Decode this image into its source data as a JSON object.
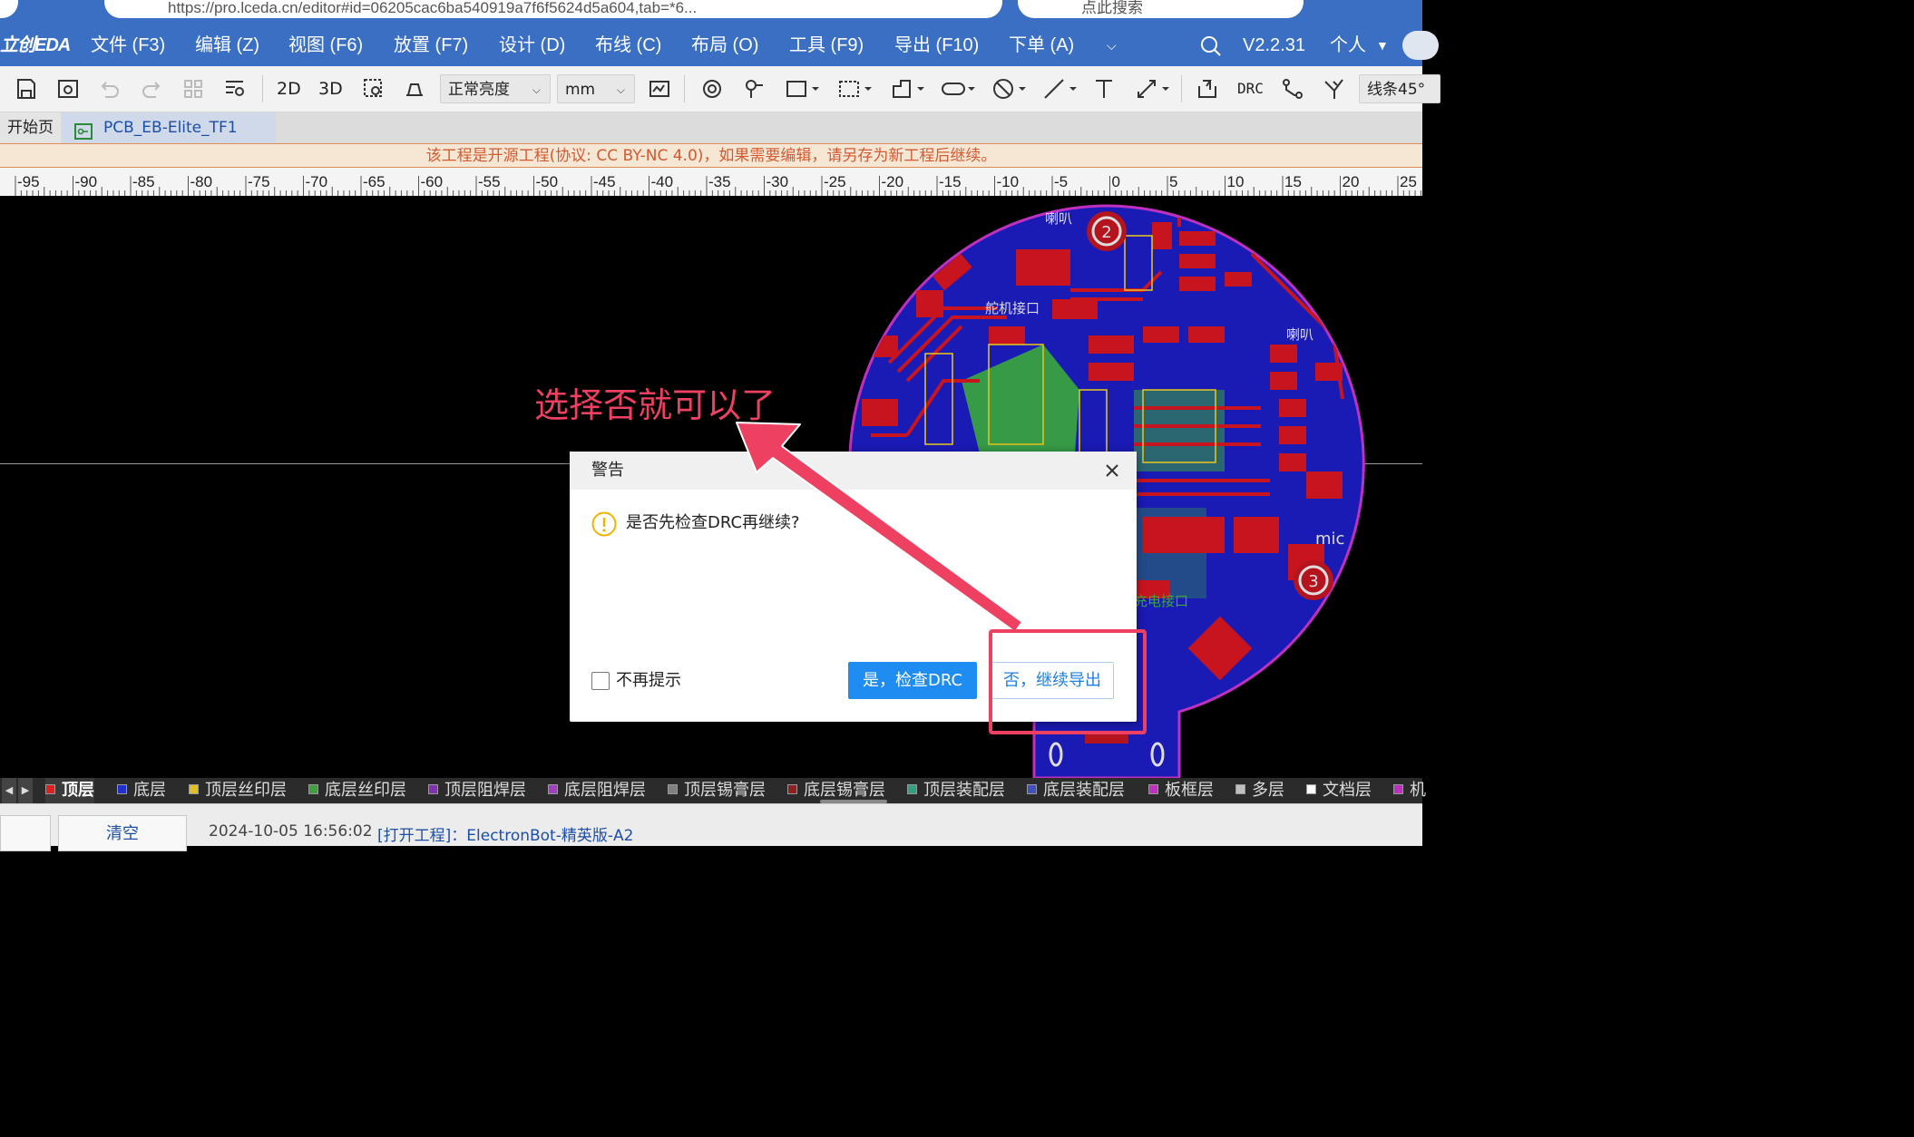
{
  "browser": {
    "url": "https://pro.lceda.cn/editor#id=06205cac6ba540919a7f6f5624d5a604,tab=*6...",
    "search_placeholder": "点此搜索"
  },
  "app": {
    "logo": "立创EDA",
    "version": "V2.2.31",
    "user": "个人"
  },
  "menu": {
    "items": [
      "文件 (F3)",
      "编辑 (Z)",
      "视图 (F6)",
      "放置 (F7)",
      "设计 (D)",
      "布线 (C)",
      "布局 (O)",
      "工具 (F9)",
      "导出 (F10)",
      "下单 (A)"
    ]
  },
  "toolbar": {
    "btn_2d": "2D",
    "btn_3d": "3D",
    "brightness": "正常亮度",
    "unit": "mm",
    "drc": "DRC",
    "route_mode": "线条45°"
  },
  "tabs": {
    "home": "开始页",
    "project": "PCB_EB-Elite_TF1"
  },
  "notice": "该工程是开源工程(协议: CC BY-NC 4.0)，如果需要编辑，请另存为新工程后继续。",
  "ruler": {
    "labels": [
      "-95",
      "-90",
      "-85",
      "-80",
      "-75",
      "-70",
      "-65",
      "-60",
      "-55",
      "-50",
      "-45",
      "-40",
      "-35",
      "-30",
      "-25",
      "-20",
      "-15",
      "-10",
      "-5",
      "0",
      "5",
      "10",
      "15",
      "20",
      "25"
    ]
  },
  "pcb": {
    "silk_labels": [
      "喇叭",
      "舵机接口",
      "喇叭",
      "mic",
      "充电接口",
      "2",
      "3"
    ]
  },
  "dialog": {
    "title": "警告",
    "message": "是否先检查DRC再继续?",
    "checkbox_label": "不再提示",
    "btn_yes": "是，检查DRC",
    "btn_no": "否，继续导出"
  },
  "annotation": {
    "text": "选择否就可以了",
    "color": "#ee4060"
  },
  "layers": [
    {
      "name": "顶层",
      "color": "#e02020",
      "active": true
    },
    {
      "name": "底层",
      "color": "#2030d0"
    },
    {
      "name": "顶层丝印层",
      "color": "#e0c020"
    },
    {
      "name": "底层丝印层",
      "color": "#40a040"
    },
    {
      "name": "顶层阻焊层",
      "color": "#8030b0"
    },
    {
      "name": "底层阻焊层",
      "color": "#a040c0"
    },
    {
      "name": "顶层锡膏层",
      "color": "#808080"
    },
    {
      "name": "底层锡膏层",
      "color": "#902020"
    },
    {
      "name": "顶层装配层",
      "color": "#30a080"
    },
    {
      "name": "底层装配层",
      "color": "#4050c0"
    },
    {
      "name": "板框层",
      "color": "#c030c0"
    },
    {
      "name": "多层",
      "color": "#c0c0c0"
    },
    {
      "name": "文档层",
      "color": "#ffffff"
    },
    {
      "name": "机",
      "color": "#c030c0"
    }
  ],
  "status": {
    "clear_btn": "清空",
    "log_time": "2024-10-05 16:56:02",
    "log_msg": "[打开工程]：ElectronBot-精英版-A2"
  }
}
